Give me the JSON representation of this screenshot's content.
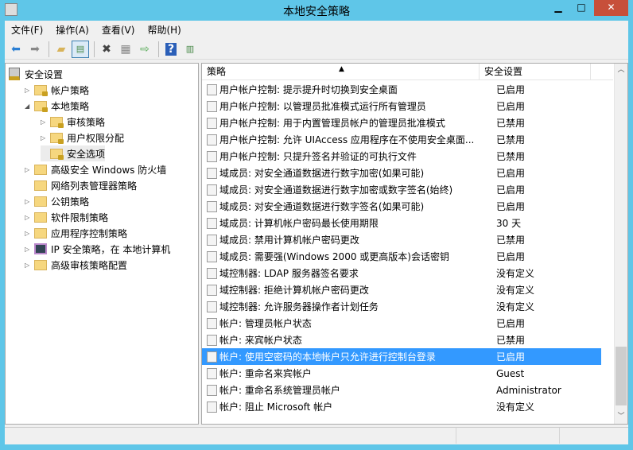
{
  "window": {
    "title": "本地安全策略",
    "minimize": "▁",
    "maximize": "□",
    "close": "✕"
  },
  "menu": [
    "文件(F)",
    "操作(A)",
    "查看(V)",
    "帮助(H)"
  ],
  "toolbar": [
    "back-icon",
    "forward-icon",
    "up-folder-icon",
    "show-hide-tree-icon",
    "delete-icon",
    "properties-icon",
    "export-list-icon",
    "help-icon",
    "action-pane-icon"
  ],
  "tree": [
    {
      "label": "安全设置",
      "level": 0,
      "expanded": true,
      "icon": "security-icon"
    },
    {
      "label": "帐户策略",
      "level": 1,
      "hasChildren": true,
      "icon": "folder-lock"
    },
    {
      "label": "本地策略",
      "level": 1,
      "expanded": true,
      "icon": "folder-lock"
    },
    {
      "label": "审核策略",
      "level": 2,
      "hasChildren": true,
      "icon": "folder-lock"
    },
    {
      "label": "用户权限分配",
      "level": 2,
      "hasChildren": true,
      "icon": "folder-lock"
    },
    {
      "label": "安全选项",
      "level": 2,
      "selected": true,
      "icon": "folder-lock"
    },
    {
      "label": "高级安全 Windows 防火墙",
      "level": 1,
      "hasChildren": true,
      "icon": "folder"
    },
    {
      "label": "网络列表管理器策略",
      "level": 1,
      "icon": "folder"
    },
    {
      "label": "公钥策略",
      "level": 1,
      "hasChildren": true,
      "icon": "folder"
    },
    {
      "label": "软件限制策略",
      "level": 1,
      "hasChildren": true,
      "icon": "folder"
    },
    {
      "label": "应用程序控制策略",
      "level": 1,
      "hasChildren": true,
      "icon": "folder"
    },
    {
      "label": "IP 安全策略，在 本地计算机",
      "level": 1,
      "hasChildren": true,
      "icon": "computer"
    },
    {
      "label": "高级审核策略配置",
      "level": 1,
      "hasChildren": true,
      "icon": "folder"
    }
  ],
  "columns": {
    "policy": "策略",
    "setting": "安全设置"
  },
  "rows": [
    {
      "policy": "用户帐户控制: 提示提升时切换到安全桌面",
      "setting": "已启用"
    },
    {
      "policy": "用户帐户控制: 以管理员批准模式运行所有管理员",
      "setting": "已启用"
    },
    {
      "policy": "用户帐户控制: 用于内置管理员帐户的管理员批准模式",
      "setting": "已禁用"
    },
    {
      "policy": "用户帐户控制: 允许 UIAccess 应用程序在不使用安全桌面...",
      "setting": "已禁用"
    },
    {
      "policy": "用户帐户控制: 只提升签名并验证的可执行文件",
      "setting": "已禁用"
    },
    {
      "policy": "域成员: 对安全通道数据进行数字加密(如果可能)",
      "setting": "已启用"
    },
    {
      "policy": "域成员: 对安全通道数据进行数字加密或数字签名(始终)",
      "setting": "已启用"
    },
    {
      "policy": "域成员: 对安全通道数据进行数字签名(如果可能)",
      "setting": "已启用"
    },
    {
      "policy": "域成员: 计算机帐户密码最长使用期限",
      "setting": "30 天"
    },
    {
      "policy": "域成员: 禁用计算机帐户密码更改",
      "setting": "已禁用"
    },
    {
      "policy": "域成员: 需要强(Windows 2000 或更高版本)会话密钥",
      "setting": "已启用"
    },
    {
      "policy": "域控制器: LDAP 服务器签名要求",
      "setting": "没有定义"
    },
    {
      "policy": "域控制器: 拒绝计算机帐户密码更改",
      "setting": "没有定义"
    },
    {
      "policy": "域控制器: 允许服务器操作者计划任务",
      "setting": "没有定义"
    },
    {
      "policy": "帐户: 管理员帐户状态",
      "setting": "已启用"
    },
    {
      "policy": "帐户: 来宾帐户状态",
      "setting": "已禁用"
    },
    {
      "policy": "帐户: 使用空密码的本地帐户只允许进行控制台登录",
      "setting": "已启用",
      "selected": true
    },
    {
      "policy": "帐户: 重命名来宾帐户",
      "setting": "Guest"
    },
    {
      "policy": "帐户: 重命名系统管理员帐户",
      "setting": "Administrator"
    },
    {
      "policy": "帐户: 阻止 Microsoft 帐户",
      "setting": "没有定义"
    }
  ],
  "colors": {
    "frame": "#5fc6e8",
    "close": "#c74f3a",
    "selection": "#3399ff"
  }
}
